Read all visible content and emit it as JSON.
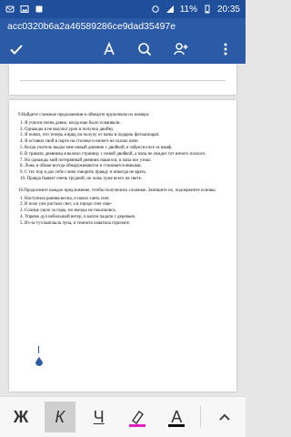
{
  "status_bar": {
    "battery_percent": "11%",
    "time": "20:35"
  },
  "window": {
    "title": "acc0320b6a2a46589286ce9dad35497e"
  },
  "toolbar": {
    "accept_icon": "check-icon",
    "font_icon": "font-a-icon",
    "search_icon": "search-icon",
    "share_icon": "share-icon",
    "more_icon": "more-vertical-icon"
  },
  "document": {
    "exercise9_title": "9.Найдите сложные предложения и обведите кружочком их номера:",
    "exercise9_items": [
      "1. Я учился очень давно, когда еще было осваивали.",
      "2. Однажды я не выучил урок и получил двойку.",
      "3. Я понял, что теперь я вряд ли получу от папы в подарок фотоаппарат.",
      "4. Я оставил свой в парте на столике и ничего не сказал папе.",
      "5. Когда учитель выдал мне новый дневник с двойкой, я забросил все за шкаф.",
      "6. В травлях дневника я вклеил страницу с новой двойкой, а папа не увидел тот ничего плохого.",
      "7. Но однажды мой потерянный дневник нашелся, и папа все узнал.",
      "8. Ложь и обман всегда обнаруживаются и становятся явными.",
      "9. С тех пор я дал себе слово говорить правду и никогда не врать.",
      "10. Правда бывает очень трудной, но ложь хуже всего на свете."
    ],
    "exercise10_title": "10.Продолжите каждое предложение, чтобы получились сложные. Запишите их, подчеркните основы.",
    "exercise10_items": [
      "1. Наступила ранняя весна, и начал таять снег.",
      "2. В поле уже растаял снег, а в городе снег еще-",
      "3. Солнце ушло за горы, но звезды не показались.",
      "4. Упрямо дул небольшой ветер, и капли падали с деревьев.",
      "5. Из-за туч выплыла луна, и темнота охватила горизонт."
    ]
  },
  "format_bar": {
    "bold_label": "Ж",
    "italic_label": "К",
    "underline_label": "Ч",
    "highlight_color": "#e020c0",
    "font_color_label": "A",
    "font_color": "#111111",
    "expand_icon": "chevron-up-icon"
  },
  "colors": {
    "accent": "#2b5aa6",
    "status_bar": "#1f4e9a"
  }
}
